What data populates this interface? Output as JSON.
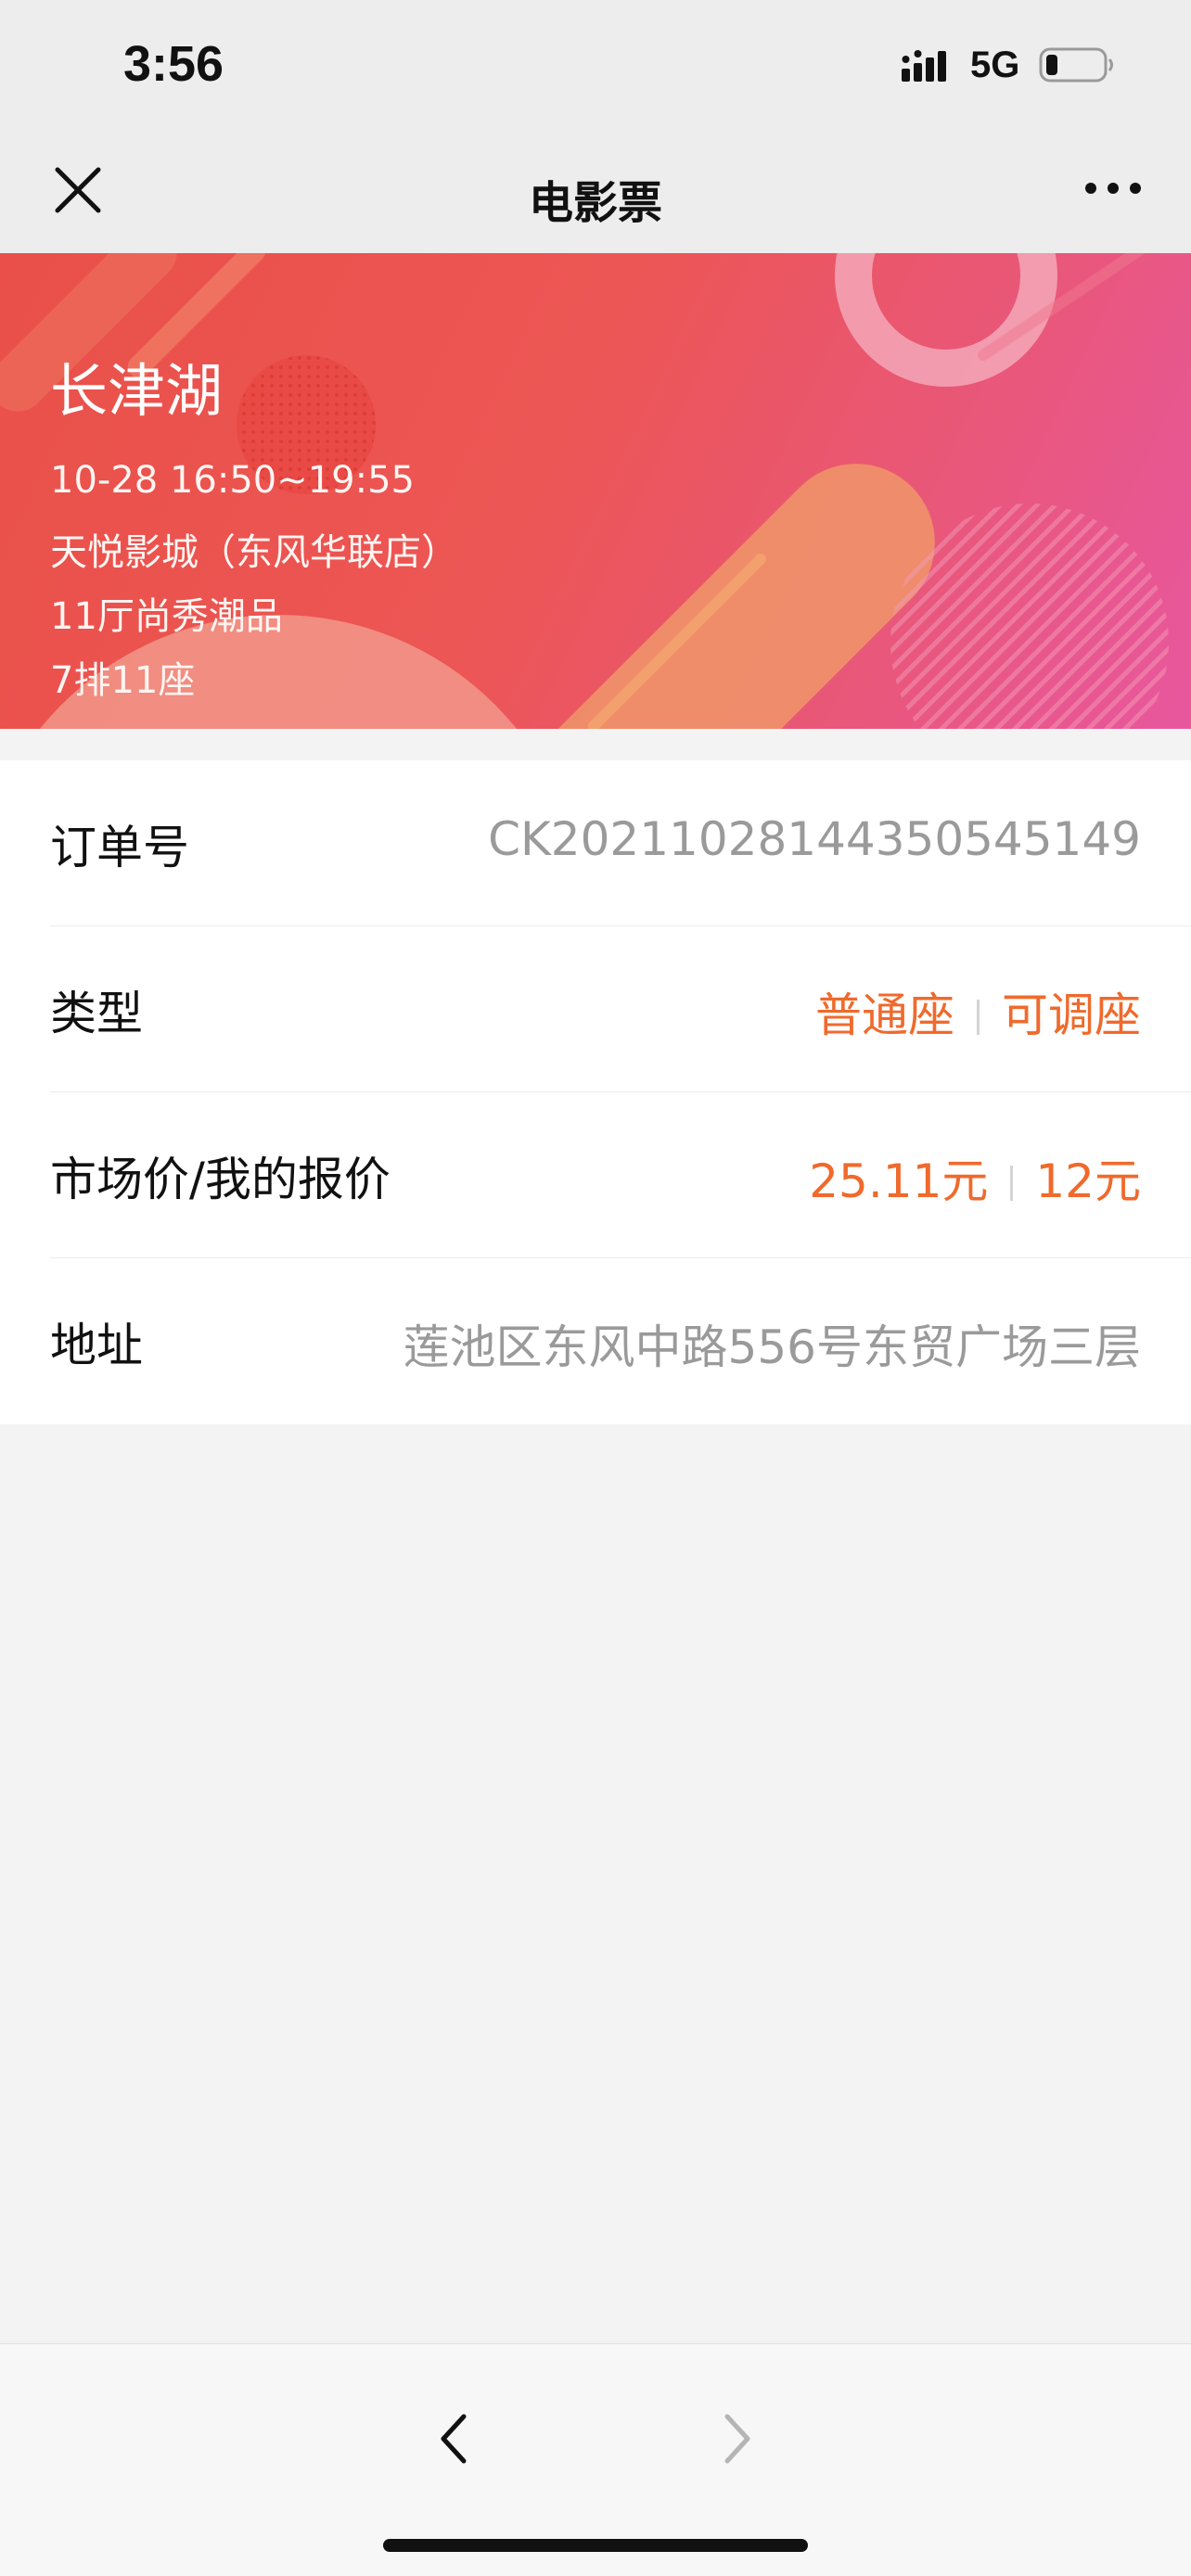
{
  "status_bar": {
    "time": "3:56",
    "network": "5G",
    "signal_icon": "signal-bars-icon",
    "battery_icon": "battery-icon",
    "battery_level": 0.2
  },
  "nav": {
    "title": "电影票",
    "close_icon": "close-icon",
    "more_icon": "more-dots-icon"
  },
  "ticket": {
    "movie_title": "长津湖",
    "showtime": "10-28 16:50~19:55",
    "cinema": "天悦影城（东风华联店）",
    "hall": "11厅尚秀潮品",
    "seat": "7排11座"
  },
  "details": {
    "order_no": {
      "label": "订单号",
      "value": "CK20211028144350545149"
    },
    "type": {
      "label": "类型",
      "value_1": "普通座",
      "value_2": "可调座"
    },
    "price": {
      "label": "市场价/我的报价",
      "value_1": "25.11元",
      "value_2": "12元"
    },
    "address": {
      "label": "地址",
      "value": "莲池区东风中路556号东贸广场三层"
    }
  },
  "toolbar": {
    "back_icon": "chevron-left-icon",
    "forward_icon": "chevron-right-icon"
  },
  "colors": {
    "accent_orange": "#ef6a2c",
    "banner_start": "#ea5049",
    "banner_end": "#e8579e"
  }
}
